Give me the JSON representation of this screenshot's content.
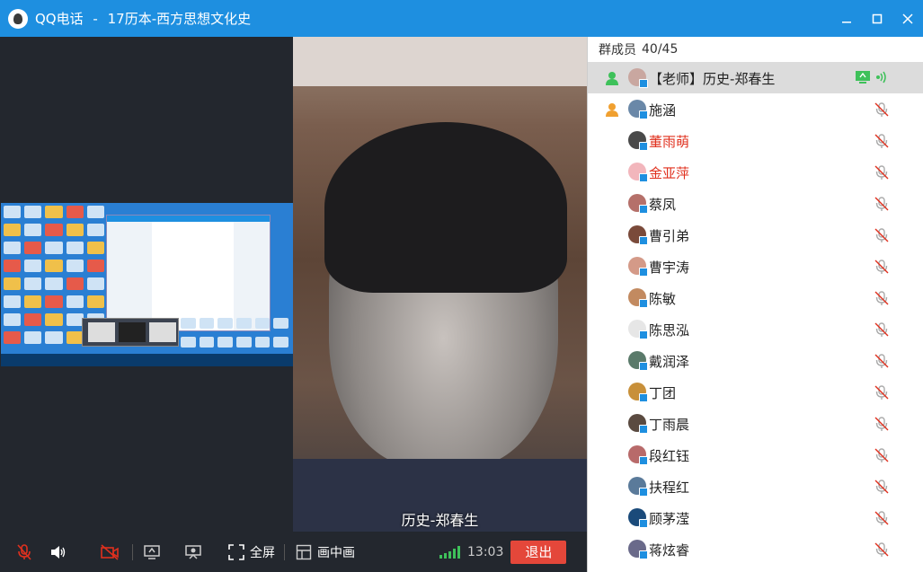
{
  "window": {
    "app_name": "QQ电话",
    "separator": "-",
    "call_title": "17历本-西方思想文化史"
  },
  "main_video": {
    "name_label": "历史-郑春生"
  },
  "toolbar": {
    "fullscreen_label": "全屏",
    "pip_label": "画中画",
    "time": "13:03",
    "exit_label": "退出"
  },
  "members": {
    "header_label": "群成员",
    "count": "40/45",
    "list": [
      {
        "name": "【老师】历史-郑春生",
        "color": "#222222",
        "avatar": "#c9a7a0",
        "role": true,
        "sharing": true,
        "indent": false
      },
      {
        "name": "施涵",
        "color": "#222222",
        "avatar": "#6a88a8",
        "role": true,
        "sharing": false,
        "indent": false
      },
      {
        "name": "董雨萌",
        "color": "#e0301e",
        "avatar": "#4a4a4a",
        "role": false,
        "sharing": false,
        "indent": true
      },
      {
        "name": "金亚萍",
        "color": "#e0301e",
        "avatar": "#f2b6bc",
        "role": false,
        "sharing": false,
        "indent": true
      },
      {
        "name": "蔡凤",
        "color": "#222222",
        "avatar": "#b5706a",
        "role": false,
        "sharing": false,
        "indent": true
      },
      {
        "name": "曹引弟",
        "color": "#222222",
        "avatar": "#7a4a3a",
        "role": false,
        "sharing": false,
        "indent": true
      },
      {
        "name": "曹宇涛",
        "color": "#222222",
        "avatar": "#d49a88",
        "role": false,
        "sharing": false,
        "indent": true
      },
      {
        "name": "陈敏",
        "color": "#222222",
        "avatar": "#c28a60",
        "role": false,
        "sharing": false,
        "indent": true
      },
      {
        "name": "陈思泓",
        "color": "#222222",
        "avatar": "#e6e6e6",
        "role": false,
        "sharing": false,
        "indent": true
      },
      {
        "name": "戴润泽",
        "color": "#222222",
        "avatar": "#5a7a6a",
        "role": false,
        "sharing": false,
        "indent": true
      },
      {
        "name": "丁团",
        "color": "#222222",
        "avatar": "#c8903a",
        "role": false,
        "sharing": false,
        "indent": true
      },
      {
        "name": "丁雨晨",
        "color": "#222222",
        "avatar": "#5a4a40",
        "role": false,
        "sharing": false,
        "indent": true
      },
      {
        "name": "段红钰",
        "color": "#222222",
        "avatar": "#b86a6a",
        "role": false,
        "sharing": false,
        "indent": true
      },
      {
        "name": "扶程红",
        "color": "#222222",
        "avatar": "#5a7a9a",
        "role": false,
        "sharing": false,
        "indent": true
      },
      {
        "name": "顾茅滢",
        "color": "#222222",
        "avatar": "#1a4a7a",
        "role": false,
        "sharing": false,
        "indent": true
      },
      {
        "name": "蒋炫睿",
        "color": "#222222",
        "avatar": "#6a6a8a",
        "role": false,
        "sharing": false,
        "indent": true
      }
    ]
  },
  "icons": {
    "app": "qq-penguin-icon",
    "minimize": "minimize-icon",
    "maximize": "maximize-icon",
    "close": "close-icon",
    "mic_muted": "mic-muted-icon",
    "speaker": "speaker-icon",
    "camera_off": "camera-off-icon",
    "share_screen": "share-screen-icon",
    "presentation": "presentation-icon",
    "fullscreen": "fullscreen-icon",
    "pip": "pip-icon",
    "signal": "signal-icon"
  },
  "colors": {
    "titlebar": "#1e8fe0",
    "exit": "#e4473a",
    "signal": "#3ec15a",
    "selected_row": "#dcdcdc"
  }
}
